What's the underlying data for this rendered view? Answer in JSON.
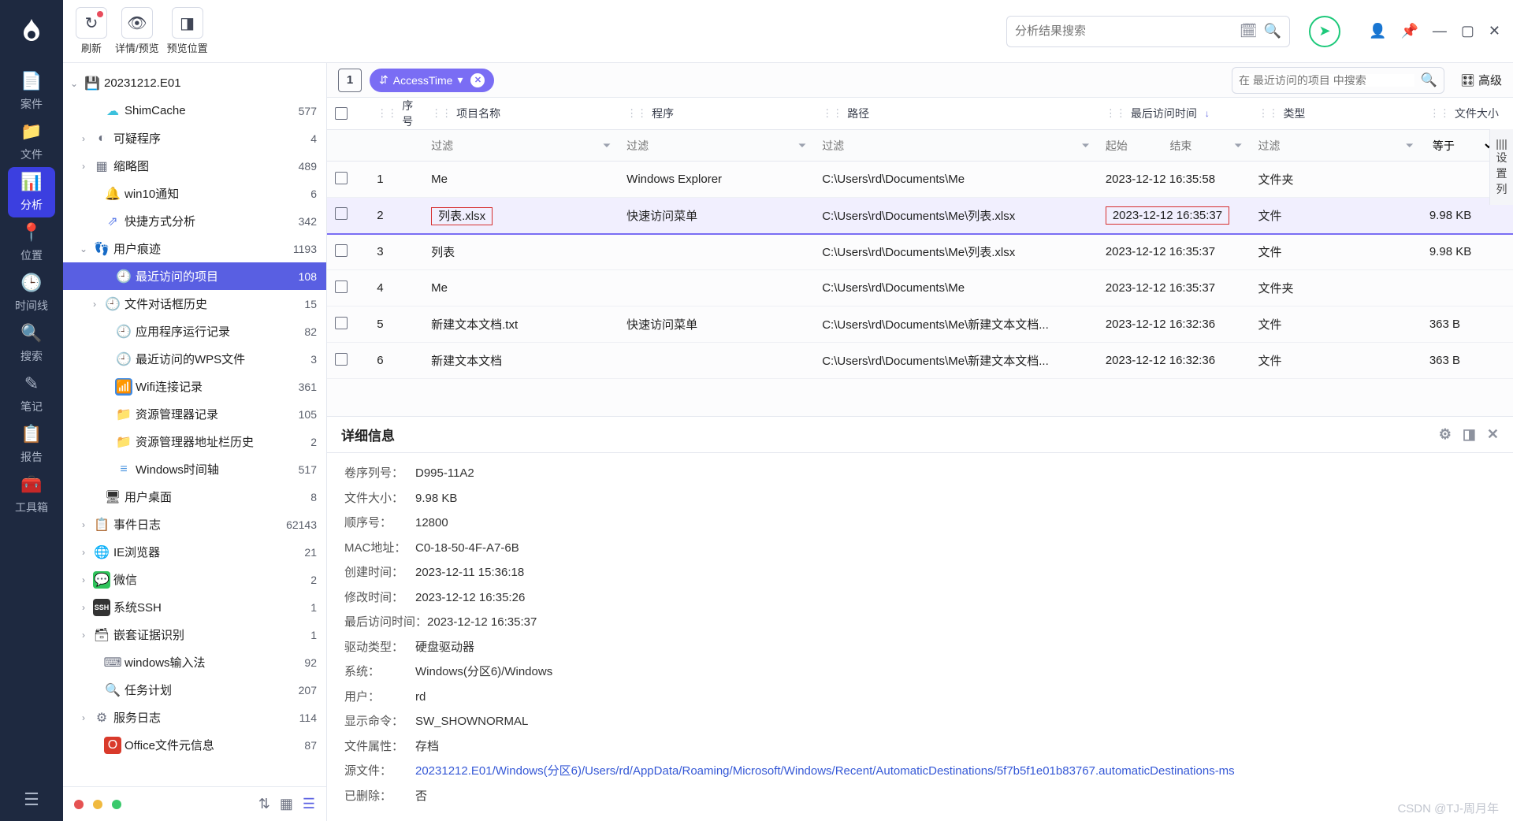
{
  "rail": {
    "items": [
      {
        "icon": "📄",
        "label": "案件"
      },
      {
        "icon": "📁",
        "label": "文件"
      },
      {
        "icon": "📊",
        "label": "分析"
      },
      {
        "icon": "📍",
        "label": "位置"
      },
      {
        "icon": "🕒",
        "label": "时间线"
      },
      {
        "icon": "🔍",
        "label": "搜索"
      },
      {
        "icon": "✎",
        "label": "笔记"
      },
      {
        "icon": "📋",
        "label": "报告"
      },
      {
        "icon": "🧰",
        "label": "工具箱"
      }
    ],
    "active_index": 2
  },
  "topbar": {
    "refresh": "刷新",
    "detail_preview": "详情/预览",
    "preview_pos": "预览位置",
    "search_placeholder": "分析结果搜索"
  },
  "tree": {
    "root": {
      "label": "20231212.E01"
    },
    "items": [
      {
        "indent": 28,
        "chev": "",
        "icon": "☁",
        "label": "ShimCache",
        "count": "577",
        "iconColor": "#3cc1dd"
      },
      {
        "indent": 14,
        "chev": "›",
        "icon": "◐",
        "label": "可疑程序",
        "count": "4",
        "iconColor": "#6b7080"
      },
      {
        "indent": 14,
        "chev": "›",
        "icon": "▦",
        "label": "缩略图",
        "count": "489",
        "iconColor": "#6b7080"
      },
      {
        "indent": 28,
        "chev": "",
        "icon": "🔔",
        "label": "win10通知",
        "count": "6",
        "iconColor": "#6d8af6"
      },
      {
        "indent": 28,
        "chev": "",
        "icon": "⇗",
        "label": "快捷方式分析",
        "count": "342",
        "iconColor": "#5b7be8"
      },
      {
        "indent": 14,
        "chev": "⌄",
        "icon": "👣",
        "label": "用户痕迹",
        "count": "1193",
        "iconColor": "#5b7be8"
      },
      {
        "indent": 42,
        "chev": "",
        "icon": "🕘",
        "label": "最近访问的项目",
        "count": "108",
        "iconColor": "#ea7d3e",
        "active": true
      },
      {
        "indent": 28,
        "chev": "›",
        "icon": "🕘",
        "label": "文件对话框历史",
        "count": "15",
        "iconColor": "#e86a4a"
      },
      {
        "indent": 42,
        "chev": "",
        "icon": "🕘",
        "label": "应用程序运行记录",
        "count": "82",
        "iconColor": "#e86a4a"
      },
      {
        "indent": 42,
        "chev": "",
        "icon": "🕘",
        "label": "最近访问的WPS文件",
        "count": "3",
        "iconColor": "#e86a4a"
      },
      {
        "indent": 42,
        "chev": "",
        "icon": "📶",
        "label": "Wifi连接记录",
        "count": "361",
        "iconColor": "#3b8ae6",
        "iconBg": "#3b8ae6"
      },
      {
        "indent": 42,
        "chev": "",
        "icon": "📁",
        "label": "资源管理器记录",
        "count": "105",
        "iconColor": "#f2c24b"
      },
      {
        "indent": 42,
        "chev": "",
        "icon": "📁",
        "label": "资源管理器地址栏历史",
        "count": "2",
        "iconColor": "#f2c24b"
      },
      {
        "indent": 42,
        "chev": "",
        "icon": "≡",
        "label": "Windows时间轴",
        "count": "517",
        "iconColor": "#4e96e1"
      },
      {
        "indent": 28,
        "chev": "",
        "icon": "🖥",
        "label": "用户桌面",
        "count": "8",
        "iconColor": "#333"
      },
      {
        "indent": 14,
        "chev": "›",
        "icon": "📋",
        "label": "事件日志",
        "count": "62143",
        "iconColor": "#e86a4a"
      },
      {
        "indent": 14,
        "chev": "›",
        "icon": "🌐",
        "label": "IE浏览器",
        "count": "21",
        "iconColor": "#3b8ae6"
      },
      {
        "indent": 14,
        "chev": "›",
        "icon": "💬",
        "label": "微信",
        "count": "2",
        "iconColor": "#2ec35b",
        "iconBg": "#2ec35b"
      },
      {
        "indent": 14,
        "chev": "›",
        "icon": "SSH",
        "label": "系统SSH",
        "count": "1",
        "iconColor": "#fff",
        "iconBg": "#333",
        "small": true
      },
      {
        "indent": 14,
        "chev": "›",
        "icon": "🗃",
        "label": "嵌套证据识别",
        "count": "1",
        "iconColor": "#333"
      },
      {
        "indent": 28,
        "chev": "",
        "icon": "⌨",
        "label": "windows输入法",
        "count": "92",
        "iconColor": "#6b7080"
      },
      {
        "indent": 28,
        "chev": "",
        "icon": "🔍",
        "label": "任务计划",
        "count": "207",
        "iconColor": "#4a9de0"
      },
      {
        "indent": 14,
        "chev": "›",
        "icon": "⚙",
        "label": "服务日志",
        "count": "114",
        "iconColor": "#6b7080"
      },
      {
        "indent": 28,
        "chev": "",
        "icon": "O",
        "label": "Office文件元信息",
        "count": "87",
        "iconColor": "#fff",
        "iconBg": "#d93a2b"
      }
    ]
  },
  "filter": {
    "tab": "1",
    "pill_label": "AccessTime",
    "search_placeholder": "在 最近访问的项目 中搜索",
    "advanced": "高级"
  },
  "table": {
    "cols": [
      "序号",
      "项目名称",
      "程序",
      "路径",
      "最后访问时间",
      "类型",
      "文件大小"
    ],
    "filter_ph": "过滤",
    "start": "起始",
    "end": "结束",
    "eq": "等于",
    "rows": [
      {
        "n": "1",
        "name": "Me",
        "prog": "Windows Explorer",
        "path": "C:\\Users\\rd\\Documents\\Me",
        "time": "2023-12-12 16:35:58",
        "type": "文件夹",
        "size": ""
      },
      {
        "n": "2",
        "name": "列表.xlsx",
        "prog": "快速访问菜单",
        "path": "C:\\Users\\rd\\Documents\\Me\\列表.xlsx",
        "time": "2023-12-12 16:35:37",
        "type": "文件",
        "size": "9.98 KB",
        "sel": true,
        "hl_name": true,
        "hl_time": true
      },
      {
        "n": "3",
        "name": "列表",
        "prog": "",
        "path": "C:\\Users\\rd\\Documents\\Me\\列表.xlsx",
        "time": "2023-12-12 16:35:37",
        "type": "文件",
        "size": "9.98 KB"
      },
      {
        "n": "4",
        "name": "Me",
        "prog": "",
        "path": "C:\\Users\\rd\\Documents\\Me",
        "time": "2023-12-12 16:35:37",
        "type": "文件夹",
        "size": ""
      },
      {
        "n": "5",
        "name": "新建文本文档.txt",
        "prog": "快速访问菜单",
        "path": "C:\\Users\\rd\\Documents\\Me\\新建文本文档...",
        "time": "2023-12-12 16:32:36",
        "type": "文件",
        "size": "363 B"
      },
      {
        "n": "6",
        "name": "新建文本文档",
        "prog": "",
        "path": "C:\\Users\\rd\\Documents\\Me\\新建文本文档...",
        "time": "2023-12-12 16:32:36",
        "type": "文件",
        "size": "363 B"
      }
    ],
    "cfg": "设置列"
  },
  "detail": {
    "title": "详细信息",
    "rows": [
      {
        "lbl": "卷序列号：",
        "val": "D995-11A2"
      },
      {
        "lbl": "文件大小：",
        "val": "9.98 KB"
      },
      {
        "lbl": "顺序号：",
        "val": "12800"
      },
      {
        "lbl": "MAC地址：",
        "val": "C0-18-50-4F-A7-6B"
      },
      {
        "lbl": "创建时间：",
        "val": "2023-12-11 15:36:18"
      },
      {
        "lbl": "修改时间：",
        "val": "2023-12-12 16:35:26"
      },
      {
        "lbl": "最后访问时间：",
        "val": "2023-12-12 16:35:37"
      },
      {
        "lbl": "驱动类型：",
        "val": "硬盘驱动器"
      },
      {
        "lbl": "系统：",
        "val": "Windows(分区6)/Windows"
      },
      {
        "lbl": "用户：",
        "val": "rd"
      },
      {
        "lbl": "显示命令：",
        "val": "SW_SHOWNORMAL"
      },
      {
        "lbl": "文件属性：",
        "val": "存档"
      },
      {
        "lbl": "源文件：",
        "val": "20231212.E01/Windows(分区6)/Users/rd/AppData/Roaming/Microsoft/Windows/Recent/AutomaticDestinations/5f7b5f1e01b83767.automaticDestinations-ms",
        "link": true
      },
      {
        "lbl": "已删除：",
        "val": "否"
      }
    ]
  },
  "watermark": "CSDN @TJ-周月年"
}
